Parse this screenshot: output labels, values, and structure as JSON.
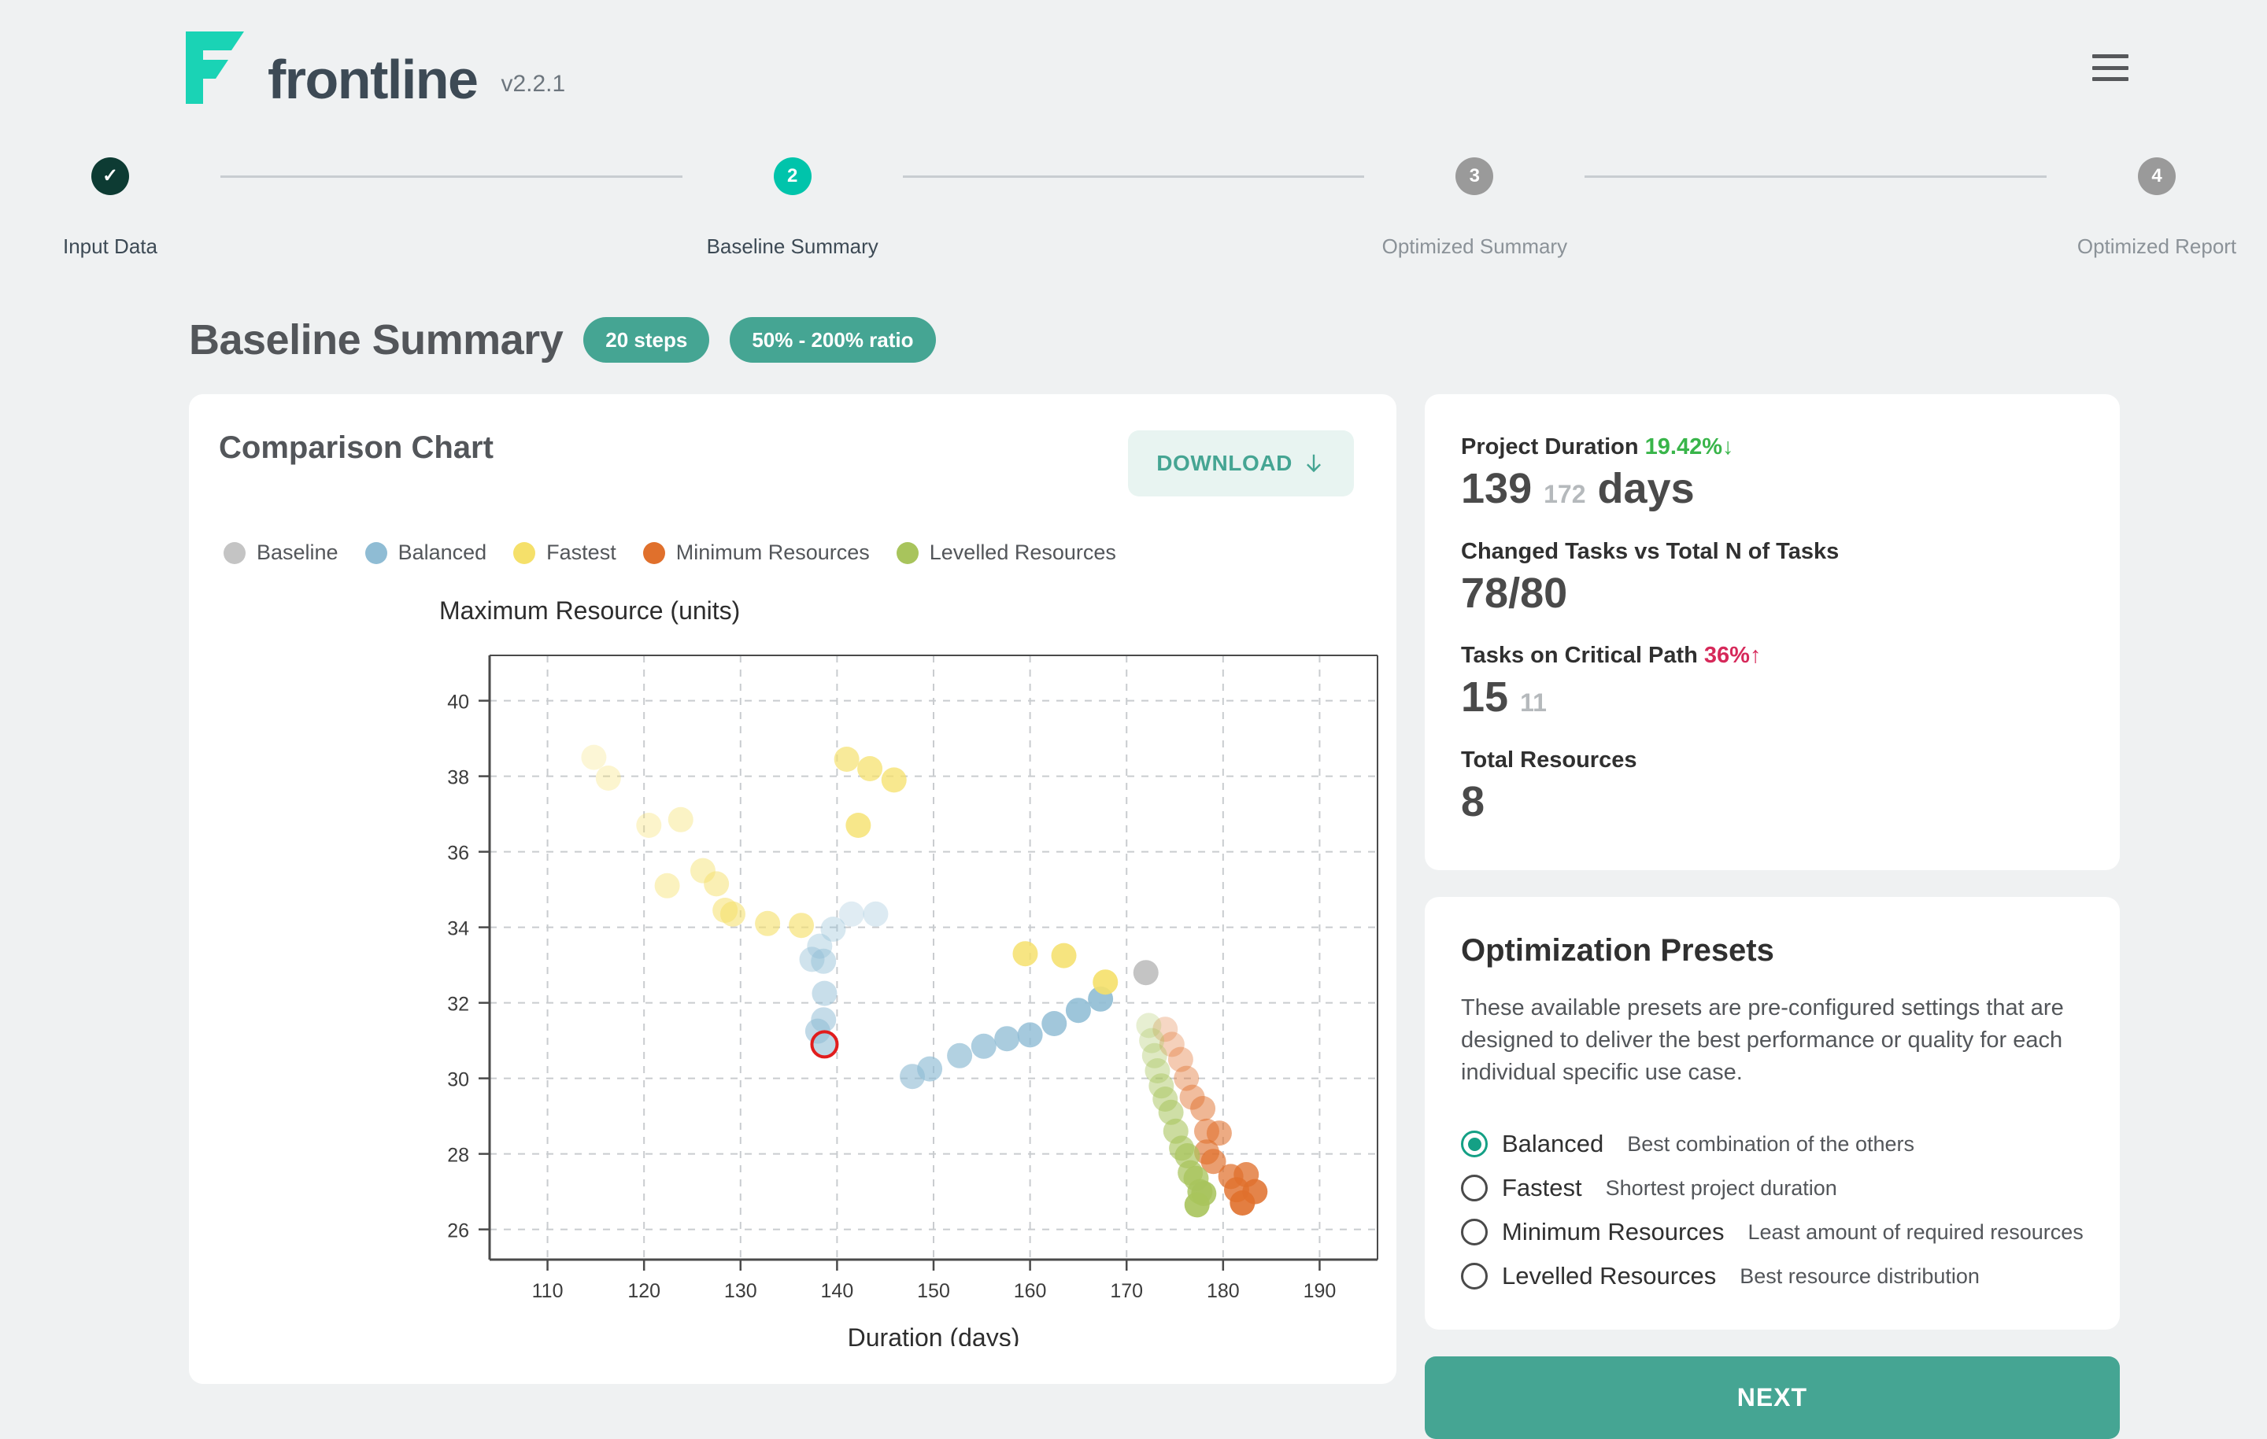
{
  "header": {
    "brand": "frontline",
    "version": "v2.2.1",
    "logo_icon": "frontline-f-logo",
    "menu_icon": "hamburger-menu-icon",
    "brand_color": "#00c4ab"
  },
  "stepper": {
    "steps": [
      {
        "num": "✓",
        "label": "Input Data",
        "state": "done"
      },
      {
        "num": "2",
        "label": "Baseline Summary",
        "state": "active"
      },
      {
        "num": "3",
        "label": "Optimized Summary",
        "state": "todo"
      },
      {
        "num": "4",
        "label": "Optimized Report",
        "state": "todo"
      }
    ]
  },
  "page": {
    "title": "Baseline Summary",
    "badge_steps": "20 steps",
    "badge_ratio": "50% - 200% ratio"
  },
  "chart_card": {
    "title": "Comparison Chart",
    "download_label": "DOWNLOAD",
    "download_icon": "download-arrow-icon"
  },
  "stats": {
    "duration_label": "Project Duration",
    "duration_delta": "19.42%",
    "duration_delta_icon": "↓",
    "duration_value": "139",
    "duration_prev": "172",
    "duration_unit": "days",
    "changed_label": "Changed Tasks vs Total N of Tasks",
    "changed_value": "78/80",
    "critical_label": "Tasks on Critical Path",
    "critical_delta": "36%",
    "critical_delta_icon": "↑",
    "critical_value": "15",
    "critical_prev": "11",
    "resources_label": "Total Resources",
    "resources_value": "8",
    "down_color": "#39b54a",
    "up_color": "#d6295a"
  },
  "presets": {
    "title": "Optimization Presets",
    "description": "These available presets are pre-configured settings that are designed to deliver the best performance or quality for each individual specific use case.",
    "options": [
      {
        "name": "Balanced",
        "desc": "Best combination of the others",
        "selected": true
      },
      {
        "name": "Fastest",
        "desc": "Shortest project duration",
        "selected": false
      },
      {
        "name": "Minimum Resources",
        "desc": "Least amount of required resources",
        "selected": false
      },
      {
        "name": "Levelled Resources",
        "desc": "Best resource distribution",
        "selected": false
      }
    ],
    "selected_color": "#14a085"
  },
  "next_button": {
    "label": "NEXT"
  },
  "chart_data": {
    "type": "scatter",
    "title": "Comparison Chart",
    "xlabel": "Duration (days)",
    "ylabel": "Maximum Resource (units)",
    "xlim": [
      104,
      196
    ],
    "ylim": [
      25.2,
      41.2
    ],
    "xticks": [
      110,
      120,
      130,
      140,
      150,
      160,
      170,
      180,
      190
    ],
    "yticks": [
      26,
      28,
      30,
      32,
      34,
      36,
      38,
      40
    ],
    "grid": true,
    "legend_position": "top-left",
    "highlight": {
      "x": 138.7,
      "y": 30.9,
      "series": "Balanced",
      "ring_color": "#e11d1d"
    },
    "series": [
      {
        "name": "Baseline",
        "color": "#c4c4c4",
        "points": [
          [
            172.0,
            32.8
          ]
        ]
      },
      {
        "name": "Balanced",
        "color": "#8fbcd4",
        "points": [
          [
            141.5,
            34.35
          ],
          [
            144.0,
            34.35
          ],
          [
            139.6,
            33.95
          ],
          [
            138.2,
            33.5
          ],
          [
            137.4,
            33.15
          ],
          [
            138.6,
            33.1
          ],
          [
            138.7,
            32.25
          ],
          [
            138.6,
            31.55
          ],
          [
            138.0,
            31.25
          ],
          [
            138.7,
            30.9
          ],
          [
            147.8,
            30.05
          ],
          [
            149.6,
            30.25
          ],
          [
            152.7,
            30.6
          ],
          [
            155.2,
            30.85
          ],
          [
            157.6,
            31.05
          ],
          [
            160.0,
            31.15
          ],
          [
            162.5,
            31.45
          ],
          [
            165.0,
            31.8
          ],
          [
            167.3,
            32.1
          ]
        ]
      },
      {
        "name": "Fastest",
        "color": "#f5e06a",
        "points": [
          [
            114.8,
            38.5
          ],
          [
            116.3,
            37.95
          ],
          [
            120.5,
            36.7
          ],
          [
            123.8,
            36.85
          ],
          [
            122.4,
            35.1
          ],
          [
            126.1,
            35.5
          ],
          [
            127.5,
            35.15
          ],
          [
            128.4,
            34.45
          ],
          [
            129.2,
            34.35
          ],
          [
            132.8,
            34.1
          ],
          [
            136.3,
            34.05
          ],
          [
            141.0,
            38.45
          ],
          [
            143.4,
            38.2
          ],
          [
            145.9,
            37.9
          ],
          [
            142.2,
            36.7
          ],
          [
            159.5,
            33.3
          ],
          [
            163.5,
            33.25
          ],
          [
            167.8,
            32.55
          ]
        ]
      },
      {
        "name": "Minimum Resources",
        "color": "#e0702c",
        "points": [
          [
            174.0,
            31.3
          ],
          [
            174.7,
            30.9
          ],
          [
            175.6,
            30.5
          ],
          [
            176.2,
            30.0
          ],
          [
            176.8,
            29.5
          ],
          [
            177.9,
            29.2
          ],
          [
            178.3,
            28.6
          ],
          [
            179.6,
            28.55
          ],
          [
            178.3,
            28.05
          ],
          [
            179.0,
            27.8
          ],
          [
            180.8,
            27.4
          ],
          [
            182.4,
            27.45
          ],
          [
            181.4,
            27.05
          ],
          [
            183.3,
            27.0
          ],
          [
            182.0,
            26.7
          ]
        ]
      },
      {
        "name": "Levelled Resources",
        "color": "#a8c45c",
        "points": [
          [
            172.3,
            31.4
          ],
          [
            172.6,
            31.0
          ],
          [
            172.9,
            30.6
          ],
          [
            173.2,
            30.2
          ],
          [
            173.6,
            29.8
          ],
          [
            174.0,
            29.45
          ],
          [
            174.6,
            29.1
          ],
          [
            175.1,
            28.6
          ],
          [
            175.7,
            28.15
          ],
          [
            176.3,
            27.95
          ],
          [
            176.6,
            27.5
          ],
          [
            177.2,
            27.35
          ],
          [
            177.6,
            27.0
          ],
          [
            178.0,
            26.95
          ],
          [
            177.3,
            26.65
          ]
        ]
      }
    ]
  }
}
